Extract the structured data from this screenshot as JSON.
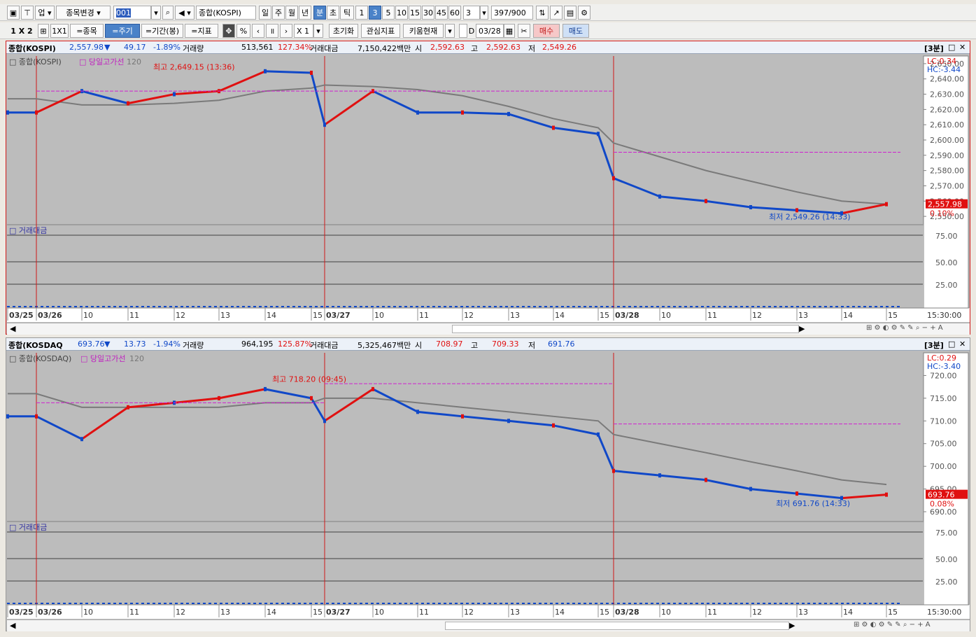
{
  "toolbar1": {
    "market": "업",
    "change_label": "종목변경",
    "code": "001",
    "name": "종합(KOSPI)",
    "periods": [
      "일",
      "주",
      "월",
      "년",
      "분",
      "초",
      "틱"
    ],
    "active_period": "분",
    "minutes": [
      "1",
      "3",
      "5",
      "10",
      "15",
      "30",
      "45",
      "60"
    ],
    "active_minute": "3",
    "minute_select": "3",
    "count": "397",
    "count_total": "/900"
  },
  "toolbar2": {
    "layout": "1 X 2",
    "layout2": "1X1",
    "stock_btn": "=종목",
    "period_btn": "=주기",
    "range_btn": "=기간(봉)",
    "indicator_btn": "=지표",
    "percent": "%",
    "zoom": "X 1",
    "reset": "초기화",
    "interest": "관심지표",
    "kiwoom": "키움현재",
    "d_label": "D",
    "date": "03/28",
    "buy": "매수",
    "sell": "매도"
  },
  "panels": [
    {
      "name": "종합(KOSPI)",
      "price": "2,557.98",
      "arrow": "▼",
      "change": "49.17",
      "pct": "-1.89%",
      "vol_label": "거래량",
      "volume": "513,561",
      "vol_pct": "127.34%",
      "amt_label": "거래대금",
      "amount": "7,150,422백만",
      "open_label": "시",
      "open": "2,592.63",
      "high_label": "고",
      "high": "2,592.63",
      "low_label": "저",
      "low": "2,549.26",
      "interval": "[3분]",
      "legend_name": "종합(KOSPI)",
      "legend_line": "당일고가선",
      "legend_ma": "120",
      "lc": "LC:0.34",
      "hc": "HC:-3.44",
      "max_label": "최고 2,649.15 (13:36)",
      "min_label": "최저 2,549.26 (14:33)",
      "price_tag": "2,557.98",
      "pct_tag": "0.10%",
      "sub_label": "거래대금",
      "sub_ticks": [
        "75.00",
        "50.00",
        "25.00"
      ],
      "time_label": "15:30:00"
    },
    {
      "name": "종합(KOSDAQ",
      "price": "693.76",
      "arrow": "▼",
      "change": "13.73",
      "pct": "-1.94%",
      "vol_label": "거래량",
      "volume": "964,195",
      "vol_pct": "125.87%",
      "amt_label": "거래대금",
      "amount": "5,325,467백만",
      "open_label": "시",
      "open": "708.97",
      "high_label": "고",
      "high": "709.33",
      "low_label": "저",
      "low": "691.76",
      "interval": "[3분]",
      "legend_name": "종합(KOSDAQ)",
      "legend_line": "당일고가선",
      "legend_ma": "120",
      "lc": "LC:0.29",
      "hc": "HC:-3.40",
      "max_label": "최고 718.20 (09:45)",
      "min_label": "최저 691.76 (14:33)",
      "price_tag": "693.76",
      "pct_tag": "0.08%",
      "sub_label": "거래대금",
      "sub_ticks": [
        "75.00",
        "50.00",
        "25.00"
      ],
      "time_label": "15:30:00"
    }
  ],
  "x_ticks": [
    "03/25",
    "03/26",
    "10",
    "11",
    "12",
    "13",
    "14",
    "15",
    "03/27",
    "10",
    "11",
    "12",
    "13",
    "14",
    "15",
    "03/28",
    "10",
    "11",
    "12",
    "13",
    "14",
    "15"
  ],
  "colors": {
    "up": "#e01010",
    "down": "#1048c8",
    "ma": "#7a7a7a",
    "highline": "#d020d0",
    "daysep": "#d01818"
  },
  "chart_data": [
    {
      "type": "line",
      "title": "종합(KOSPI)",
      "ylim": [
        2545,
        2655
      ],
      "y_ticks": [
        2550,
        2560,
        2570,
        2580,
        2590,
        2600,
        2610,
        2620,
        2630,
        2640,
        2650
      ],
      "categories": [
        "03/25",
        "03/26",
        "10",
        "11",
        "12",
        "13",
        "14",
        "15",
        "03/27",
        "10",
        "11",
        "12",
        "13",
        "14",
        "15",
        "03/28",
        "10",
        "11",
        "12",
        "13",
        "14",
        "15"
      ],
      "series": [
        {
          "name": "종합(KOSPI)",
          "values": [
            2618,
            2618,
            2632,
            2624,
            2630,
            2632,
            2645,
            2644,
            2610,
            2632,
            2618,
            2618,
            2617,
            2608,
            2604,
            2575,
            2563,
            2560,
            2556,
            2554,
            2552,
            2557.98
          ]
        },
        {
          "name": "120",
          "values": [
            2627,
            2627,
            2623,
            2623,
            2624,
            2626,
            2632,
            2634,
            2636,
            2635,
            2633,
            2629,
            2622,
            2614,
            2608,
            2598,
            2589,
            2580,
            2573,
            2566,
            2560,
            2558
          ]
        }
      ],
      "grid": true
    },
    {
      "type": "line",
      "title": "종합(KOSDAQ)",
      "ylim": [
        688,
        725
      ],
      "y_ticks": [
        690,
        695,
        700,
        705,
        710,
        715,
        720
      ],
      "categories": [
        "03/25",
        "03/26",
        "10",
        "11",
        "12",
        "13",
        "14",
        "15",
        "03/27",
        "10",
        "11",
        "12",
        "13",
        "14",
        "15",
        "03/28",
        "10",
        "11",
        "12",
        "13",
        "14",
        "15"
      ],
      "series": [
        {
          "name": "종합(KOSDAQ)",
          "values": [
            711,
            711,
            706,
            713,
            714,
            715,
            717,
            715,
            710,
            717,
            712,
            711,
            710,
            709,
            707,
            699,
            698,
            697,
            695,
            694,
            693,
            693.76
          ]
        },
        {
          "name": "120",
          "values": [
            716,
            716,
            713,
            713,
            713,
            713,
            714,
            714,
            715,
            715,
            714,
            713,
            712,
            711,
            710,
            707,
            705,
            703,
            701,
            699,
            697,
            696
          ]
        }
      ],
      "grid": true
    }
  ]
}
